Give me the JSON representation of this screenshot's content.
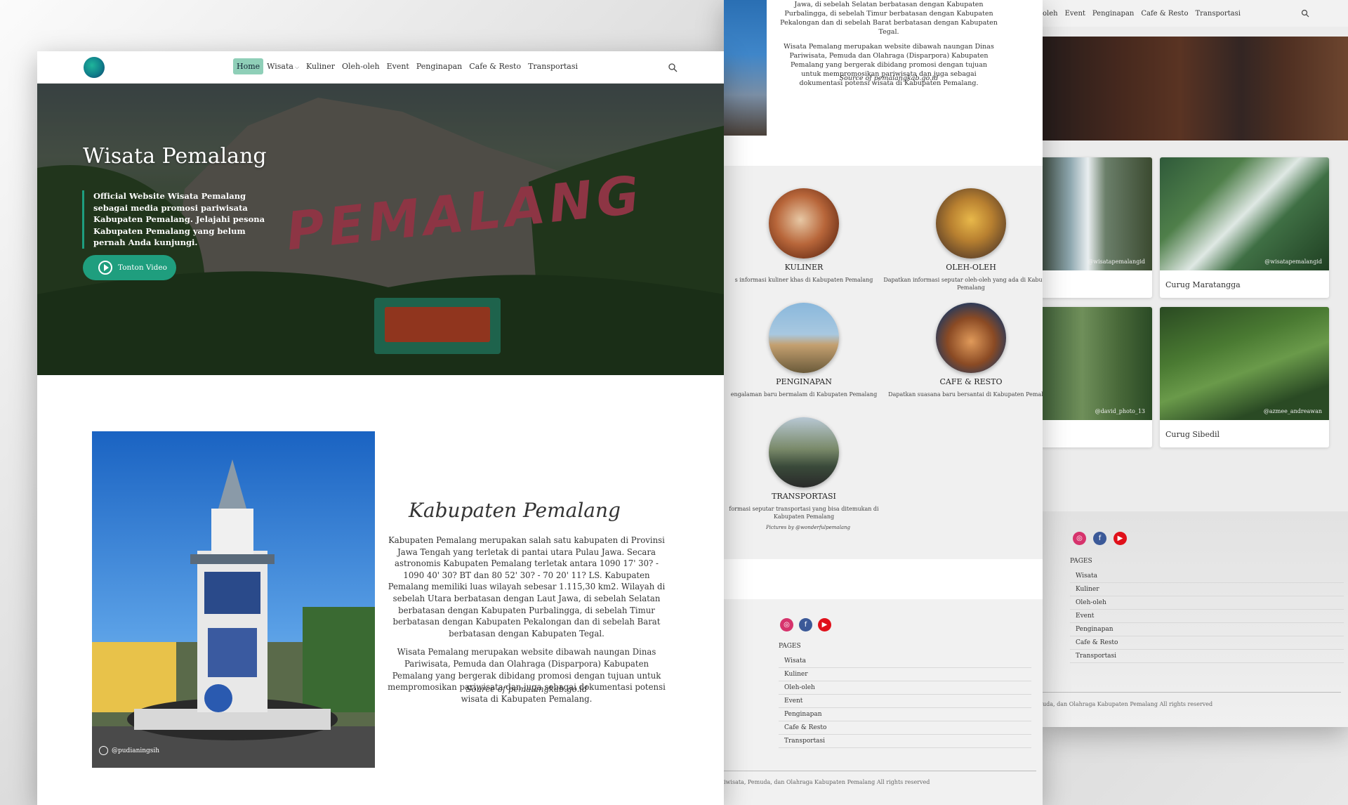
{
  "right_panel": {
    "nav": [
      "oleh",
      "Event",
      "Penginapan",
      "Cafe & Resto",
      "Transportasi"
    ],
    "cards": [
      {
        "credit": "@wisatapemalangid",
        "title": ""
      },
      {
        "credit": "@wisatapemalangid",
        "title": "Curug Maratangga"
      },
      {
        "credit": "@david_photo_13",
        "title": ""
      },
      {
        "credit": "@azmee_andreawan",
        "title": "Curug Sibedil"
      }
    ],
    "footer": {
      "pages_title": "PAGES",
      "pages": [
        "Wisata",
        "Kuliner",
        "Oleh-oleh",
        "Event",
        "Penginapan",
        "Cafe & Resto",
        "Transportasi"
      ],
      "copyright": "uda, dan Olahraga Kabupaten Pemalang All rights reserved"
    }
  },
  "middle_panel": {
    "intro_lines": [
      "Jawa, di sebelah Selatan berbatasan dengan Kabupaten Purbalingga, di sebelah Timur berbatasan dengan Kabupaten Pekalongan dan di sebelah Barat berbatasan dengan Kabupaten Tegal.",
      "Wisata Pemalang merupakan website dibawah naungan Dinas Pariwisata, Pemuda dan Olahraga (Disparpora) Kabupaten Pemalang yang bergerak dibidang promosi dengan tujuan untuk mempromosikan pariwisata dan juga sebagai dokumentasi potensi wisata di Kabupaten Pemalang."
    ],
    "source": "Source of pemalangkab.go.id",
    "categories": [
      {
        "label": "KULINER",
        "desc": "s informasi kuliner khas di Kabupaten Pemalang"
      },
      {
        "label": "OLEH-OLEH",
        "desc": "Dapatkan informasi seputar oleh-oleh yang ada di Kabupaten Pemalang"
      },
      {
        "label": "PENGINAPAN",
        "desc": "engalaman baru bermalam di Kabupaten Pemalang"
      },
      {
        "label": "CAFE & RESTO",
        "desc": "Dapatkan suasana baru bersantai di Kabupaten Pemalang"
      },
      {
        "label": "TRANSPORTASI",
        "desc": "formasi seputar transportasi yang bisa ditemukan di Kabupaten Pemalang"
      }
    ],
    "pictures_credit": "Pictures by @wonderfulpemalang",
    "footer": {
      "pages_title": "PAGES",
      "pages": [
        "Wisata",
        "Kuliner",
        "Oleh-oleh",
        "Event",
        "Penginapan",
        "Cafe & Resto",
        "Transportasi"
      ],
      "copyright": "iwisata, Pemuda, dan Olahraga Kabupaten Pemalang All rights reserved"
    }
  },
  "main": {
    "nav": {
      "items": [
        "Home",
        "Wisata",
        "Kuliner",
        "Oleh-oleh",
        "Event",
        "Penginapan",
        "Cafe & Resto",
        "Transportasi"
      ]
    },
    "hero": {
      "title": "Wisata Pemalang",
      "description": "Official Website Wisata Pemalang sebagai media promosi pariwisata Kabupaten Pemalang. Jelajahi pesona Kabupaten Pemalang yang belum pernah Anda kunjungi.",
      "video_button": "Tonton Video",
      "sign_text": "PEMALANG"
    },
    "about": {
      "photo_credit": "@pudianingsih",
      "title": "Kabupaten Pemalang",
      "paragraph1": "Kabupaten Pemalang merupakan salah satu kabupaten di Provinsi Jawa Tengah yang terletak di pantai utara Pulau Jawa. Secara astronomis Kabupaten Pemalang terletak antara 1090 17' 30? - 1090 40' 30? BT dan 80 52' 30? - 70 20' 11? LS. Kabupaten Pemalang memiliki luas wilayah sebesar 1.115,30 km2. Wilayah di sebelah Utara berbatasan dengan Laut Jawa, di sebelah Selatan berbatasan dengan Kabupaten Purbalingga, di sebelah Timur berbatasan dengan Kabupaten Pekalongan dan di sebelah Barat berbatasan dengan Kabupaten Tegal.",
      "paragraph2": "Wisata Pemalang merupakan website dibawah naungan Dinas Pariwisata, Pemuda dan Olahraga (Disparpora) Kabupaten Pemalang yang bergerak dibidang promosi dengan tujuan untuk mempromosikan pariwisata dan juga sebagai dokumentasi potensi wisata di Kabupaten Pemalang.",
      "source": "Source of pemalangkab.go.id"
    }
  }
}
